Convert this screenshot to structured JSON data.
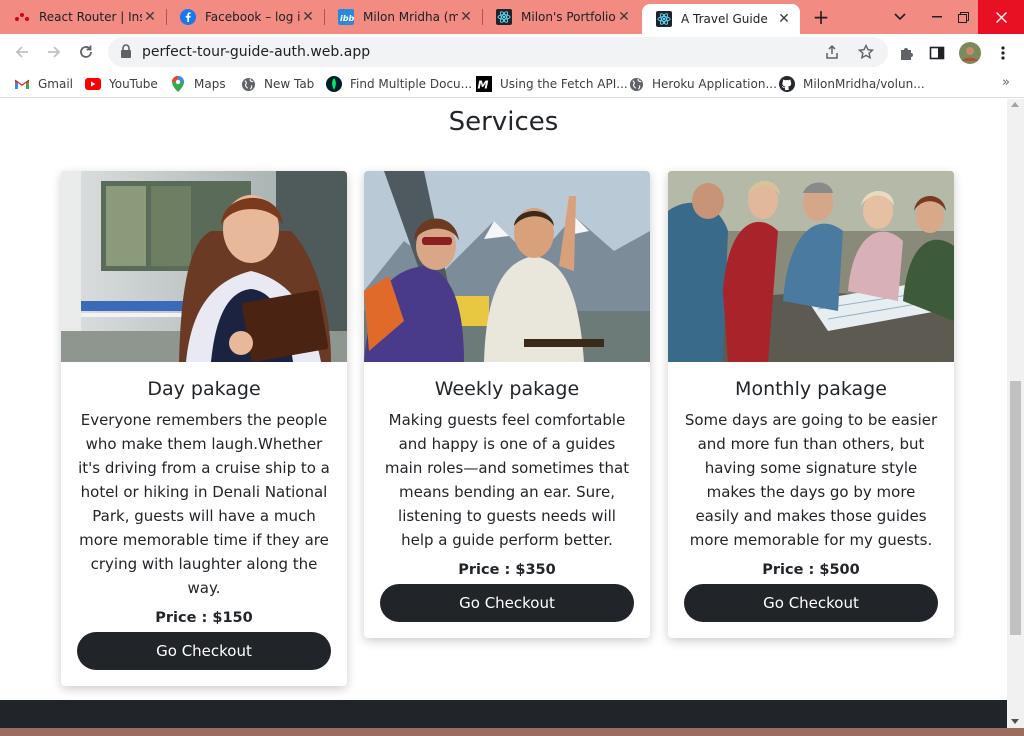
{
  "tabs": [
    {
      "title": "React Router | Ins",
      "icon": "react-router-icon",
      "active": false
    },
    {
      "title": "Facebook – log in",
      "icon": "facebook-icon",
      "active": false
    },
    {
      "title": "Milon Mridha (mil",
      "icon": "ibb-icon",
      "active": false
    },
    {
      "title": "Milon's Portfolio",
      "icon": "react-icon",
      "active": false
    },
    {
      "title": "A Travel Guide",
      "icon": "react-icon",
      "active": true
    }
  ],
  "address_bar": {
    "url": "perfect-tour-guide-auth.web.app"
  },
  "bookmarks": [
    {
      "label": "Gmail",
      "icon": "gmail-icon"
    },
    {
      "label": "YouTube",
      "icon": "youtube-icon"
    },
    {
      "label": "Maps",
      "icon": "maps-icon"
    },
    {
      "label": "New Tab",
      "icon": "globe-icon"
    },
    {
      "label": "Find Multiple Docu...",
      "icon": "mongodb-leaf-icon"
    },
    {
      "label": "Using the Fetch API...",
      "icon": "mdn-icon"
    },
    {
      "label": "Heroku Application...",
      "icon": "globe-icon"
    },
    {
      "label": "MilonMridha/volun...",
      "icon": "github-icon"
    }
  ],
  "page": {
    "services_title": "Services",
    "cards": [
      {
        "title": "Day pakage",
        "description": "Everyone remembers the people who make them laugh.Whether it's driving from a cruise ship to a hotel or hiking in Denali National Park, guests will have a much more memorable time if they are crying with laughter along the way.",
        "price": "Price : $150",
        "button": "Go Checkout",
        "image": "woman-guide-by-bus-photo"
      },
      {
        "title": "Weekly pakage",
        "description": "Making guests feel comfortable and happy is one of a guides main roles—and sometimes that means bending an ear. Sure, listening to guests needs will help a guide perform better.",
        "price": "Price : $350",
        "button": "Go Checkout",
        "image": "guide-pointing-mountains-photo"
      },
      {
        "title": "Monthly pakage",
        "description": "Some days are going to be easier and more fun than others, but having some signature style makes the days go by more easily and makes those guides more memorable for my guests.",
        "price": "Price : $500",
        "button": "Go Checkout",
        "image": "group-reading-map-photo"
      }
    ]
  },
  "colors": {
    "tabstrip": "#f28b82",
    "button_dark": "#212529",
    "footer": "#212529"
  }
}
